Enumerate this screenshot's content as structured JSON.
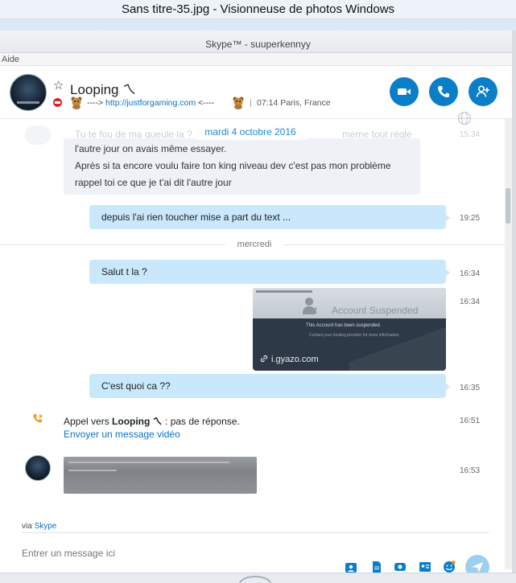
{
  "viewer": {
    "title": "Sans titre-35.jpg - Visionneuse de photos Windows"
  },
  "skype_window": {
    "title": "Skype™ - suuperkennyy"
  },
  "menu": {
    "help": "Aide"
  },
  "contact": {
    "name": "Looping ㄟ",
    "mood_prefix": "----> ",
    "mood_link": "http://justforgaming.com",
    "mood_suffix": " <----",
    "separator": "|",
    "local_time": "07:14 Paris, France",
    "status": "do-not-disturb",
    "status_color": "#d0262d"
  },
  "header_buttons": [
    {
      "name": "video-call",
      "icon": "camera-icon"
    },
    {
      "name": "audio-call",
      "icon": "phone-icon"
    },
    {
      "name": "add-contact",
      "icon": "add-person-icon"
    }
  ],
  "accent_color": "#0a7fc7",
  "conversation": {
    "ghost_text": "Tu te fou de ma gueule la ? T",
    "ghost_text_right": "meme tout réglé",
    "ghost_time": "15:34",
    "date_pill": "mardi 4 octobre 2016",
    "message_1": {
      "lines": [
        "l'autre jour on avais même essayer.",
        "Après si ta encore voulu faire ton king niveau dev c'est pas mon problème",
        "rappel toi ce que je t'ai dit l'autre jour"
      ]
    },
    "message_2": {
      "text": "depuis l'ai rien toucher mise a part du text ...",
      "time": "19:25"
    },
    "day_divider": "mercredi",
    "message_3": {
      "text": "Salut t la ?",
      "time": "16:34"
    },
    "image_message": {
      "time": "16:34",
      "heading": "Account Suspended",
      "body_1": "This Account has been suspended.",
      "body_2": "Contact your hosting provider for more information.",
      "source": "i.gyazo.com"
    },
    "message_4": {
      "text": "C'est quoi ca ??",
      "time": "16:35"
    },
    "call": {
      "prefix": "Appel vers ",
      "name": "Looping ㄟ",
      "suffix": " : pas de réponse.",
      "link": "Envoyer un message vidéo",
      "time": "16:51"
    },
    "blurred_message": {
      "time": "16:53"
    }
  },
  "footer": {
    "via_prefix": "via ",
    "via_link": "Skype",
    "placeholder": "Entrer un message ici"
  }
}
